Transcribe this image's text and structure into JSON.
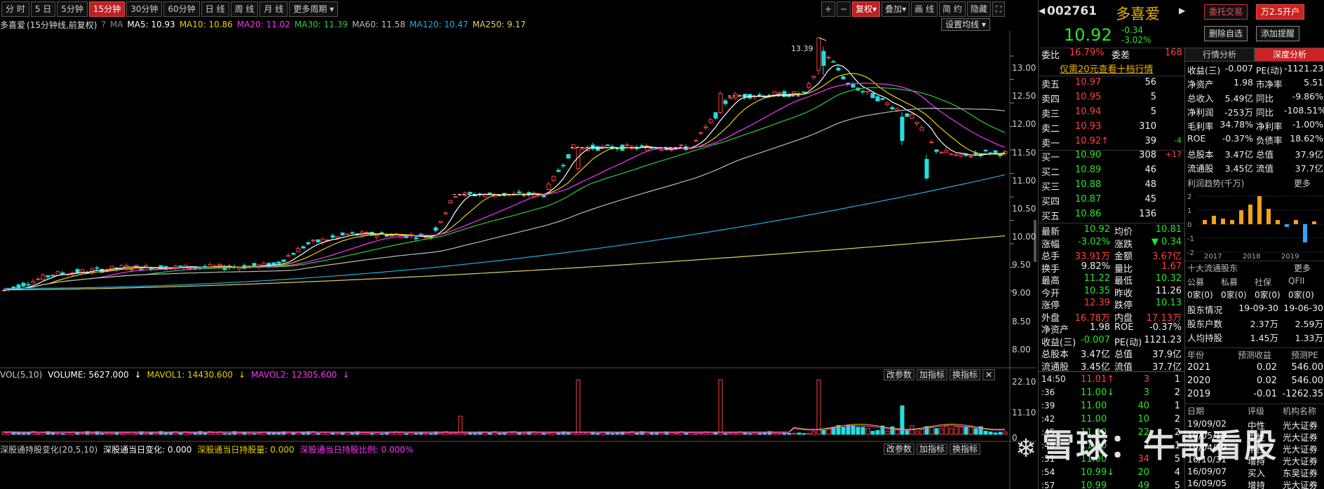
{
  "toolbar": {
    "periods": [
      "分 时",
      "5 日",
      "5分钟",
      "15分钟",
      "30分钟",
      "60分钟",
      "日 线",
      "周 线",
      "月 线",
      "更多周期"
    ],
    "active": 3
  },
  "toolbar_right": {
    "plus": "+",
    "minus": "−",
    "fuquan": "复权",
    "diejia": "叠加",
    "huaxian": "画 线",
    "jianyue": "简 约",
    "yincang": "隐藏"
  },
  "ma_header": {
    "name": "多喜爱",
    "period": "(15分钟线,前复权)",
    "ma_tag": "MA",
    "ma5": "MA5: 10.93",
    "ma10": "MA10: 10.86",
    "ma20": "MA20: 11.02",
    "ma30": "MA30: 11.39",
    "ma60": "MA60: 11.58",
    "ma120": "MA120: 10.47",
    "ma250": "MA250: 9.17"
  },
  "set_ma_label": "设置均线",
  "price_axis": [
    "13.00",
    "12.50",
    "12.00",
    "11.50",
    "11.00",
    "10.50",
    "10.00",
    "9.50",
    "9.00",
    "8.50",
    "8.00"
  ],
  "high_label": "13.39",
  "vol_header": {
    "name": "VOL(5,10)",
    "volume": "VOLUME: 5627.000",
    "mavol1": "MAVOL1: 14430.600",
    "mavol2": "MAVOL2: 12305.600"
  },
  "vol_axis": [
    "22.10",
    "11.10",
    "0"
  ],
  "panel_btns": {
    "gai": "改参数",
    "jia": "加指标",
    "huan": "换指标"
  },
  "sh_header": {
    "name": "深股通持股变化(20,5,10)",
    "a": "深股通当日变化: 0.000",
    "b": "深股通当日持股量: 0.000",
    "c": "深股通当日持股比例: 0.000%"
  },
  "quote": {
    "code": "002761",
    "name": "多喜爱",
    "price": "10.92",
    "chg": "-0.34",
    "pct": "-3.02%",
    "btn1": "委托交易",
    "btn2": "万2.5开户",
    "btn3": "删除自选",
    "btn4": "添加提醒"
  },
  "weibi": {
    "label1": "委比",
    "val1": "16.79%",
    "label2": "委差",
    "val2": "168"
  },
  "ten_level_tip": "仅需20元查看十档行情",
  "asks": [
    {
      "l": "卖五",
      "p": "10.97",
      "v": "56",
      "d": ""
    },
    {
      "l": "卖四",
      "p": "10.95",
      "v": "5",
      "d": ""
    },
    {
      "l": "卖三",
      "p": "10.94",
      "v": "5",
      "d": ""
    },
    {
      "l": "卖二",
      "p": "10.93",
      "v": "310",
      "d": ""
    },
    {
      "l": "卖一",
      "p": "10.92↑",
      "v": "39",
      "d": "-4"
    }
  ],
  "bids": [
    {
      "l": "买一",
      "p": "10.90",
      "v": "308",
      "d": "+17"
    },
    {
      "l": "买二",
      "p": "10.89",
      "v": "46",
      "d": ""
    },
    {
      "l": "买三",
      "p": "10.88",
      "v": "48",
      "d": ""
    },
    {
      "l": "买四",
      "p": "10.87",
      "v": "45",
      "d": ""
    },
    {
      "l": "买五",
      "p": "10.86",
      "v": "136",
      "d": ""
    }
  ],
  "stats": [
    [
      "最新",
      "10.92",
      "均价",
      "10.81"
    ],
    [
      "涨幅",
      "-3.02%",
      "涨跌",
      "▼ 0.34"
    ],
    [
      "总手",
      "33.91万",
      "金额",
      "3.67亿"
    ],
    [
      "换手",
      "9.82%",
      "量比",
      "1.67"
    ],
    [
      "最高",
      "11.22",
      "最低",
      "10.32"
    ],
    [
      "今开",
      "10.35",
      "昨收",
      "11.26"
    ],
    [
      "涨停",
      "12.39",
      "跌停",
      "10.13"
    ],
    [
      "外盘",
      "16.78万",
      "内盘",
      "17.13万"
    ],
    [
      "净资产",
      "1.98",
      "ROE",
      "-0.37%"
    ],
    [
      "收益(三)",
      "-0.007",
      "PE(动)",
      "1121.23"
    ],
    [
      "总股本",
      "3.47亿",
      "总值",
      "37.9亿"
    ],
    [
      "流通股",
      "3.45亿",
      "流值",
      "37.7亿"
    ]
  ],
  "ticks": [
    [
      "14:50",
      "11.01↑",
      "3",
      "1"
    ],
    [
      ":36",
      "11.00↓",
      "3",
      "2"
    ],
    [
      ":39",
      "11.00",
      "40",
      "1"
    ],
    [
      ":42",
      "11.00",
      "10",
      "2"
    ],
    [
      ":45",
      "11.00",
      "22",
      "2"
    ],
    [
      ":48",
      "11.00",
      "2",
      "1"
    ],
    [
      ":51",
      "11.00",
      "34",
      "5"
    ],
    [
      ":54",
      "10.99↓",
      "20",
      "4"
    ],
    [
      ":57",
      "10.99",
      "49",
      "5"
    ]
  ],
  "tabs": {
    "a": "行情分析",
    "b": "深度分析"
  },
  "fin": [
    [
      "收益(三)",
      "-0.007",
      "PE(动)",
      "-1121.23"
    ],
    [
      "净资产",
      "1.98",
      "市净率",
      "5.51"
    ],
    [
      "总收入",
      "5.49亿",
      "同比",
      "-9.86%"
    ],
    [
      "净利润",
      "-253万",
      "同比",
      "-108.51%"
    ],
    [
      "毛利率",
      "34.78%",
      "净利率",
      "-1.00%"
    ],
    [
      "ROE",
      "-0.37%",
      "负债率",
      "18.62%"
    ],
    [
      "总股本",
      "3.47亿",
      "总值",
      "37.9亿"
    ],
    [
      "流通股",
      "3.45亿",
      "流值",
      "37.7亿"
    ]
  ],
  "profit_title": "利润趋势(千万)",
  "more": "更多",
  "profit_chart": {
    "type": "bar",
    "categories": [
      "2017",
      "2018",
      "2019"
    ],
    "yticks": [
      "2",
      "1",
      "0",
      "-1",
      "-2"
    ],
    "values": [
      0.3,
      0.6,
      0.4,
      0.3,
      1.0,
      1.4,
      2.0,
      1.1,
      0.3,
      -0.2,
      0.3,
      -1.3,
      0.2
    ]
  },
  "holders_title": "十大流通股东",
  "holders_head": [
    "公募",
    "私募",
    "社保",
    "QFII"
  ],
  "holders_vals": [
    "0家(0)",
    "0家(0)",
    "0家(0)",
    "0家(0)"
  ],
  "holders_rows": [
    [
      "股东情况",
      "19-09-30",
      "19-06-30"
    ],
    [
      "股东户数",
      "2.37万",
      "2.59万"
    ],
    [
      "人均持股",
      "1.45万",
      "1.33万"
    ]
  ],
  "forecast_head": [
    "年份",
    "预测收益",
    "预测PE"
  ],
  "forecast": [
    [
      "2021",
      "0.02",
      "546.00"
    ],
    [
      "2020",
      "0.02",
      "546.00"
    ],
    [
      "2019",
      "-0.01",
      "-1262.35"
    ]
  ],
  "rating_head": [
    "日期",
    "评级",
    "机构名称"
  ],
  "ratings": [
    [
      "19/09/02",
      "中性",
      "光大证券"
    ],
    [
      "19/05/19",
      "中性",
      "光大证券"
    ],
    [
      "19/04/19",
      "中性",
      "光大证券"
    ],
    [
      "16/10/31",
      "增持",
      "光大证券"
    ],
    [
      "16/09/07",
      "买入",
      "东吴证券"
    ],
    [
      "16/09/05",
      "增持",
      "光大证券"
    ]
  ],
  "watermark": "雪球：牛哥看股",
  "colors": {
    "up": "#ff4040",
    "down": "#27e62b",
    "cyan": "#1fe0e0",
    "ma5": "#ffffff",
    "ma10": "#e9d000",
    "ma20": "#ff33ff",
    "ma30": "#2ecc40",
    "ma60": "#bbbbbb",
    "ma120": "#1fb0e0",
    "ma250": "#e0d060"
  }
}
